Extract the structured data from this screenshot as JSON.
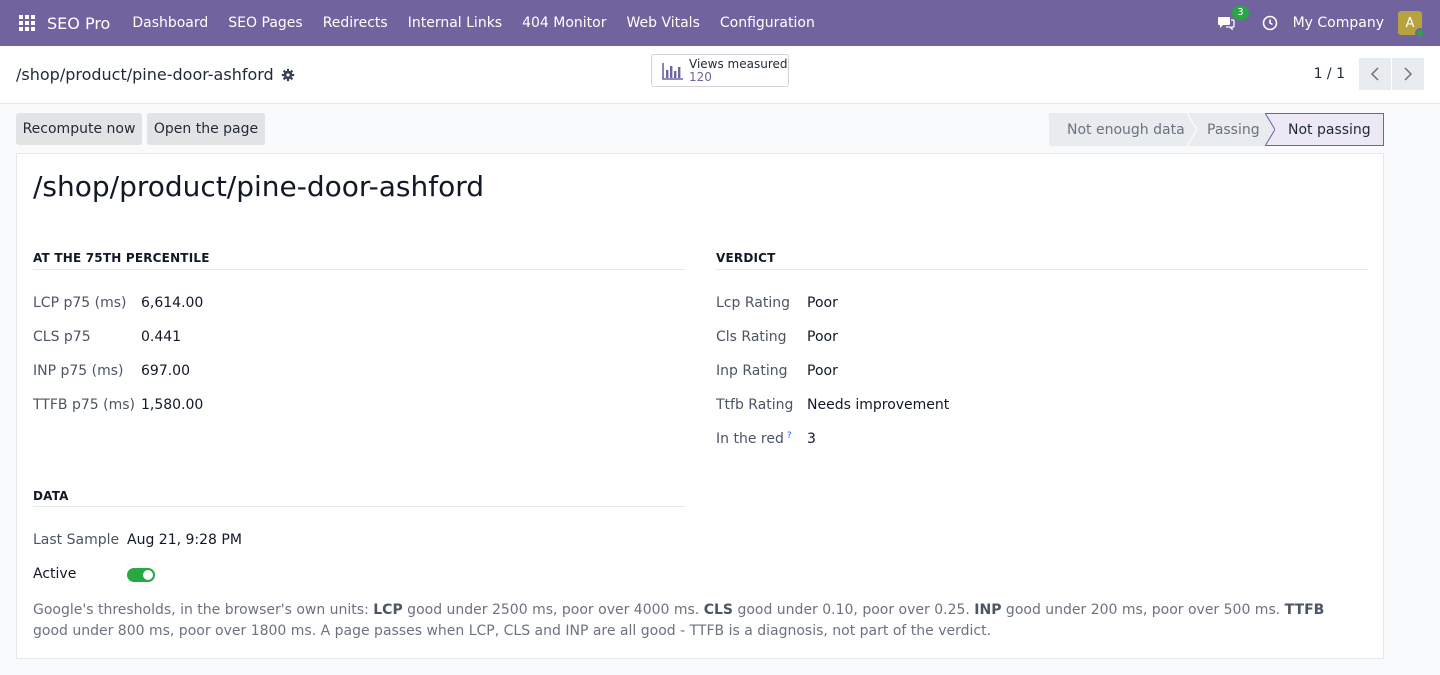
{
  "nav": {
    "brand": "SEO Pro",
    "menu": [
      "Dashboard",
      "SEO Pages",
      "Redirects",
      "Internal Links",
      "404 Monitor",
      "Web Vitals",
      "Configuration"
    ],
    "chat_count": "3",
    "company": "My Company",
    "avatar_letter": "A"
  },
  "control": {
    "breadcrumb": "/shop/product/pine-door-ashford",
    "smart_button": {
      "label": "Views measured",
      "value": "120"
    },
    "pager": "1 / 1"
  },
  "actions": {
    "recompute": "Recompute now",
    "open_page": "Open the page"
  },
  "status": {
    "stages": [
      "Not enough data",
      "Passing",
      "Not passing"
    ],
    "current": "Not passing"
  },
  "record": {
    "title": "/shop/product/pine-door-ashford",
    "percentile_section": "AT THE 75TH PERCENTILE",
    "percentile_fields": [
      {
        "label": "LCP p75 (ms)",
        "value": "6,614.00"
      },
      {
        "label": "CLS p75",
        "value": "0.441"
      },
      {
        "label": "INP p75 (ms)",
        "value": "697.00"
      },
      {
        "label": "TTFB p75 (ms)",
        "value": "1,580.00"
      }
    ],
    "verdict_section": "VERDICT",
    "verdict_fields": [
      {
        "label": "Lcp Rating",
        "value": "Poor"
      },
      {
        "label": "Cls Rating",
        "value": "Poor"
      },
      {
        "label": "Inp Rating",
        "value": "Poor"
      },
      {
        "label": "Ttfb Rating",
        "value": "Needs improvement"
      },
      {
        "label": "In the red",
        "value": "3"
      }
    ],
    "help_mark": "?",
    "data_section": "DATA",
    "last_sample_label": "Last Sample",
    "last_sample_value": "Aug 21, 9:28 PM",
    "active_label": "Active",
    "active": true,
    "note": {
      "p1": "Google's thresholds, in the browser's own units: ",
      "lcp": "LCP",
      "p2": " good under 2500 ms, poor over 4000 ms. ",
      "cls": "CLS",
      "p3": " good under 0.10, poor over 0.25. ",
      "inp": "INP",
      "p4": " good under 200 ms, poor over 500 ms. ",
      "ttfb": "TTFB",
      "p5": " good under 800 ms, poor over 1800 ms. A page passes when LCP, CLS and INP are all good - TTFB is a diagnosis, not part of the verdict."
    }
  },
  "colors": {
    "nav_bg": "#71639e",
    "accent": "#71639e",
    "toggle_on": "#28a745"
  }
}
